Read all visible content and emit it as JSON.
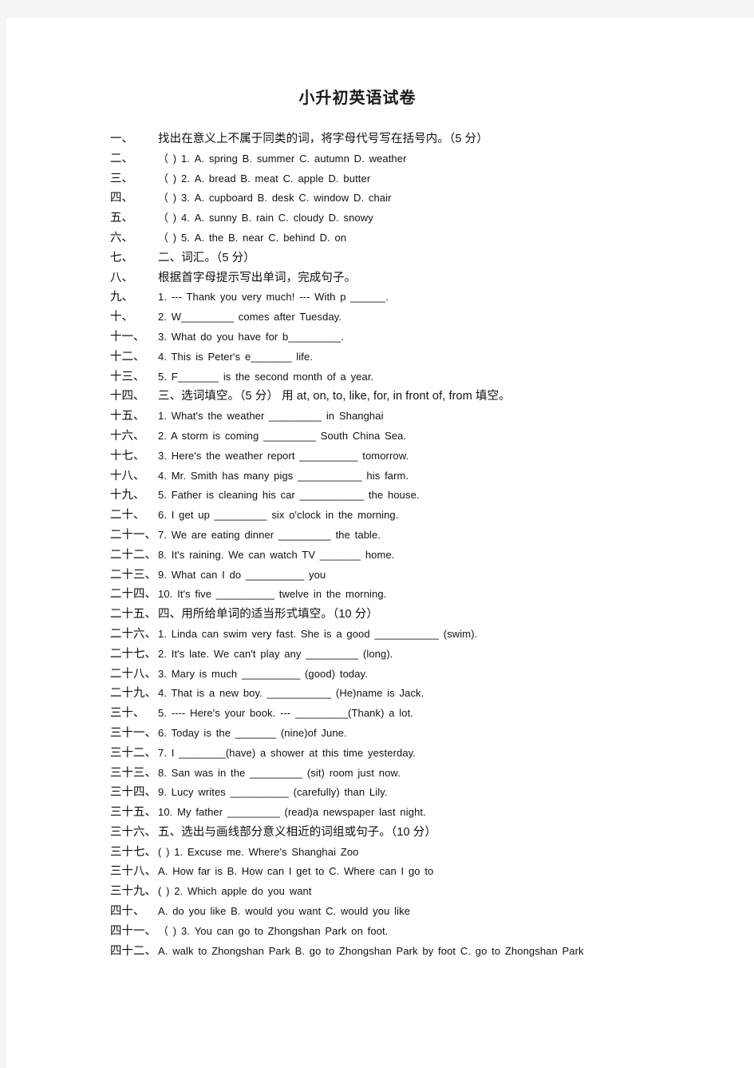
{
  "document": {
    "title": "小升初英语试卷",
    "page_background": "#ffffff",
    "canvas_background": "#f4f4f4",
    "text_color": "#111111"
  },
  "lines": [
    {
      "marker": "一、",
      "text": "找出在意义上不属于同类的词，将字母代号写在括号内。（5 分）",
      "heading": true
    },
    {
      "marker": "二、",
      "text": "（   ) 1. A. spring  B. summer  C. autumn  D. weather",
      "heading": false
    },
    {
      "marker": "三、",
      "text": "（   ) 2. A. bread  B. meat  C. apple  D. butter",
      "heading": false
    },
    {
      "marker": "四、",
      "text": "（   ) 3. A. cupboard  B. desk  C. window  D. chair",
      "heading": false
    },
    {
      "marker": "五、",
      "text": "（   ) 4. A. sunny  B. rain  C. cloudy  D. snowy",
      "heading": false
    },
    {
      "marker": "六、",
      "text": "（   ) 5. A. the  B. near  C. behind  D. on",
      "heading": false
    },
    {
      "marker": "七、",
      "text": "二、词汇。（5 分）",
      "heading": true
    },
    {
      "marker": "八、",
      "text": "根据首字母提示写出单词，完成句子。",
      "heading": true
    },
    {
      "marker": "九、",
      "text": "1. --- Thank you very much! --- With p ______.",
      "heading": false
    },
    {
      "marker": "十、",
      "text": "2. W_________ comes after Tuesday.",
      "heading": false
    },
    {
      "marker": "十一、",
      "text": "3. What do you have for b_________.",
      "heading": false
    },
    {
      "marker": "十二、",
      "text": "4. This is Peter's e_______ life.",
      "heading": false
    },
    {
      "marker": "十三、",
      "text": "5. F_______ is the second month of a year.",
      "heading": false
    },
    {
      "marker": "十四、",
      "text": "三、选词填空。（5 分）    用 at, on, to, like, for, in front of, from 填空。",
      "heading": true
    },
    {
      "marker": "十五、",
      "text": "1. What's the weather _________ in Shanghai",
      "heading": false
    },
    {
      "marker": "十六、",
      "text": "2. A storm is coming _________ South China Sea.",
      "heading": false
    },
    {
      "marker": "十七、",
      "text": "3. Here's the weather report __________ tomorrow.",
      "heading": false
    },
    {
      "marker": "十八、",
      "text": "4. Mr. Smith has many pigs ___________ his farm.",
      "heading": false
    },
    {
      "marker": "十九、",
      "text": "5. Father is cleaning his car ___________ the house.",
      "heading": false
    },
    {
      "marker": "二十、",
      "text": "6. I get up _________ six o'clock in the morning.",
      "heading": false
    },
    {
      "marker": "二十一、",
      "text": "7. We are eating dinner _________ the table.",
      "heading": false
    },
    {
      "marker": "二十二、",
      "text": "8. It's raining. We can watch TV _______ home.",
      "heading": false
    },
    {
      "marker": "二十三、",
      "text": "9. What can I do __________ you",
      "heading": false
    },
    {
      "marker": "二十四、",
      "text": "10. It's five __________ twelve in the morning.",
      "heading": false
    },
    {
      "marker": "二十五、",
      "text": "四、用所给单词的适当形式填空。（10 分）",
      "heading": true
    },
    {
      "marker": "二十六、",
      "text": "1. Linda can swim very fast. She is a good ___________ (swim).",
      "heading": false
    },
    {
      "marker": "二十七、",
      "text": "2. It's late. We can't play any _________ (long).",
      "heading": false
    },
    {
      "marker": "二十八、",
      "text": "3. Mary is much __________ (good) today.",
      "heading": false
    },
    {
      "marker": "二十九、",
      "text": "4. That is a new boy. ___________ (He)name is Jack.",
      "heading": false
    },
    {
      "marker": "三十、",
      "text": "5. ---- Here's your book. --- _________(Thank) a lot.",
      "heading": false
    },
    {
      "marker": "三十一、",
      "text": "6. Today is the _______ (nine)of June.",
      "heading": false
    },
    {
      "marker": "三十二、",
      "text": "7. I ________(have) a shower at this time yesterday.",
      "heading": false
    },
    {
      "marker": "三十三、",
      "text": "8. San was in the _________ (sit) room just now.",
      "heading": false
    },
    {
      "marker": "三十四、",
      "text": "9. Lucy writes __________ (carefully) than Lily.",
      "heading": false
    },
    {
      "marker": "三十五、",
      "text": "10. My father _________ (read)a newspaper last night.",
      "heading": false
    },
    {
      "marker": "三十六、",
      "text": "五、选出与画线部分意义相近的词组或句子。（10 分）",
      "heading": true
    },
    {
      "marker": "三十七、",
      "text": "( ) 1. Excuse me. Where's Shanghai Zoo",
      "heading": false
    },
    {
      "marker": "三十八、",
      "text": "A. How far is B. How can I get to C. Where can I go to",
      "heading": false
    },
    {
      "marker": "三十九、",
      "text": "( ) 2. Which apple do you want",
      "heading": false
    },
    {
      "marker": "四十、",
      "text": "A. do you like B. would you want C. would you like",
      "heading": false
    },
    {
      "marker": "四十一、",
      "text": "（   ) 3. You can go to Zhongshan Park on foot.",
      "heading": false
    },
    {
      "marker": "四十二、",
      "text": "A. walk to Zhongshan Park    B. go to Zhongshan Park by foot    C. go to Zhongshan Park",
      "heading": false
    }
  ]
}
